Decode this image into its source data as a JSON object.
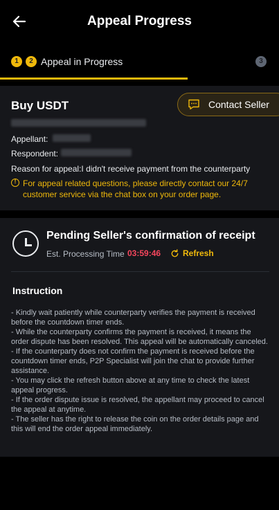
{
  "header": {
    "title": "Appeal Progress"
  },
  "steps": {
    "step1": "1",
    "step2": "2",
    "step3": "3",
    "active_label": "Appeal in Progress"
  },
  "order": {
    "title": "Buy USDT",
    "contact_seller": "Contact Seller",
    "appellant_label": "Appellant:",
    "respondent_label": "Respondent:",
    "reason_label": "Reason for appeal:",
    "reason_value": "I didn't receive payment from the counterparty",
    "notice": "For appeal related questions, please directly contact our 24/7 customer service via the chat box on your order page."
  },
  "status": {
    "title": "Pending Seller's confirmation of receipt",
    "est_label": "Est. Processing Time",
    "timer": "03:59:46",
    "refresh": "Refresh"
  },
  "instruction": {
    "title": "Instruction",
    "items": [
      "- Kindly wait patiently while counterparty verifies the payment is received before the countdown timer ends.",
      "- While the counterparty confirms the payment is received, it means the order dispute has been resolved. This appeal will be automatically canceled.",
      "- If the counterparty does not confirm the payment is received before the countdown timer ends, P2P Specialist will join the chat to provide further assistance.",
      "- You may click the refresh button above at any time to check the latest appeal progress.",
      "- If the order dispute issue is resolved, the appellant may proceed to cancel the appeal at anytime.",
      "- The seller has the right to release the coin on the order details page and this will end the order appeal immediately."
    ]
  },
  "colors": {
    "accent": "#f0b90b",
    "timer": "#f6465d",
    "background": "#000000",
    "card": "#16171b"
  }
}
